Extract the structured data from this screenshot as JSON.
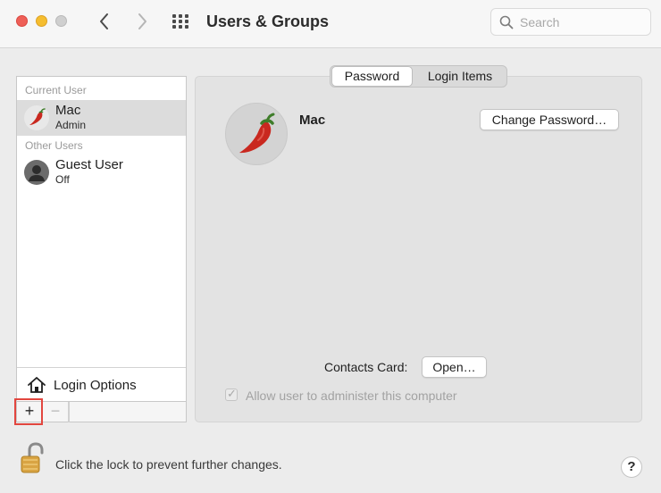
{
  "window": {
    "title": "Users & Groups",
    "search_placeholder": "Search"
  },
  "sidebar": {
    "current_user_header": "Current User",
    "other_users_header": "Other Users",
    "users": [
      {
        "name": "Mac",
        "role": "Admin",
        "avatar": "chili-pepper-icon",
        "selected": true
      },
      {
        "name": "Guest User",
        "role": "Off",
        "avatar": "person-icon",
        "selected": false
      }
    ],
    "login_options_label": "Login Options",
    "add_label": "+",
    "remove_label": "−"
  },
  "main": {
    "tabs": [
      {
        "label": "Password",
        "active": true
      },
      {
        "label": "Login Items",
        "active": false
      }
    ],
    "user_name": "Mac",
    "change_password_label": "Change Password…",
    "contacts_card_label": "Contacts Card:",
    "open_label": "Open…",
    "admin_checkbox_label": "Allow user to administer this computer",
    "admin_checked": true
  },
  "footer": {
    "lock_text": "Click the lock to prevent further changes.",
    "help_label": "?"
  },
  "colors": {
    "close": "#ee5f57",
    "minimize": "#f5bd2f",
    "zoom_disabled": "#cfcfcf",
    "highlight": "#e2463f",
    "chili_red": "#c9281f"
  }
}
